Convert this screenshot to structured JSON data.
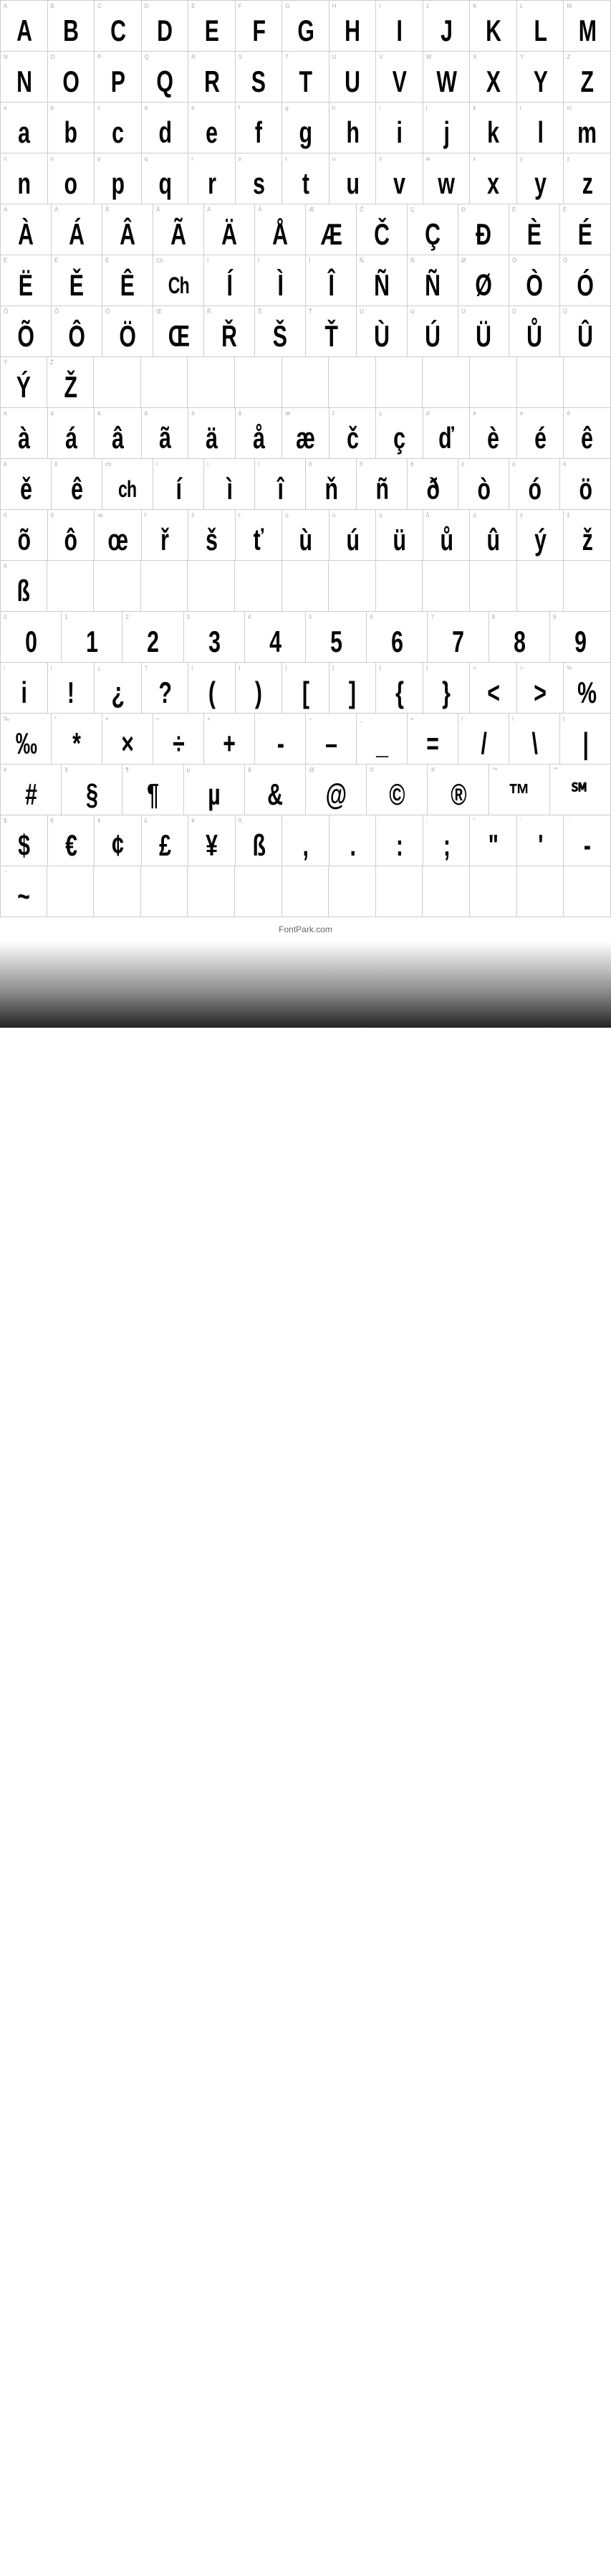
{
  "rows": [
    {
      "id": "row-upper-1",
      "cells": [
        {
          "label": "A",
          "char": "A"
        },
        {
          "label": "B",
          "char": "B"
        },
        {
          "label": "C",
          "char": "C"
        },
        {
          "label": "D",
          "char": "D"
        },
        {
          "label": "E",
          "char": "E"
        },
        {
          "label": "F",
          "char": "F"
        },
        {
          "label": "G",
          "char": "G"
        },
        {
          "label": "H",
          "char": "H"
        },
        {
          "label": "I",
          "char": "I"
        },
        {
          "label": "J",
          "char": "J"
        },
        {
          "label": "K",
          "char": "K"
        },
        {
          "label": "L",
          "char": "L"
        },
        {
          "label": "M",
          "char": "M"
        }
      ]
    },
    {
      "id": "row-upper-2",
      "cells": [
        {
          "label": "N",
          "char": "N"
        },
        {
          "label": "O",
          "char": "O"
        },
        {
          "label": "P",
          "char": "P"
        },
        {
          "label": "Q",
          "char": "Q"
        },
        {
          "label": "R",
          "char": "R"
        },
        {
          "label": "S",
          "char": "S"
        },
        {
          "label": "T",
          "char": "T"
        },
        {
          "label": "U",
          "char": "U"
        },
        {
          "label": "V",
          "char": "V"
        },
        {
          "label": "W",
          "char": "W"
        },
        {
          "label": "X",
          "char": "X"
        },
        {
          "label": "Y",
          "char": "Y"
        },
        {
          "label": "Z",
          "char": "Z"
        }
      ]
    },
    {
      "id": "row-lower-1",
      "cells": [
        {
          "label": "a",
          "char": "a"
        },
        {
          "label": "b",
          "char": "b"
        },
        {
          "label": "c",
          "char": "c"
        },
        {
          "label": "d",
          "char": "d"
        },
        {
          "label": "e",
          "char": "e"
        },
        {
          "label": "f",
          "char": "f"
        },
        {
          "label": "g",
          "char": "g"
        },
        {
          "label": "h",
          "char": "h"
        },
        {
          "label": "i",
          "char": "i"
        },
        {
          "label": "j",
          "char": "j"
        },
        {
          "label": "k",
          "char": "k"
        },
        {
          "label": "l",
          "char": "l"
        },
        {
          "label": "m",
          "char": "m"
        }
      ]
    },
    {
      "id": "row-lower-2",
      "cells": [
        {
          "label": "n",
          "char": "n"
        },
        {
          "label": "o",
          "char": "o"
        },
        {
          "label": "p",
          "char": "p"
        },
        {
          "label": "q",
          "char": "q"
        },
        {
          "label": "r",
          "char": "r"
        },
        {
          "label": "s",
          "char": "s"
        },
        {
          "label": "t",
          "char": "t"
        },
        {
          "label": "u",
          "char": "u"
        },
        {
          "label": "v",
          "char": "v"
        },
        {
          "label": "w",
          "char": "w"
        },
        {
          "label": "x",
          "char": "x"
        },
        {
          "label": "y",
          "char": "y"
        },
        {
          "label": "z",
          "char": "z"
        }
      ]
    },
    {
      "id": "row-accent-1",
      "cells": [
        {
          "label": "À",
          "char": "À"
        },
        {
          "label": "Á",
          "char": "Á"
        },
        {
          "label": "Â",
          "char": "Â"
        },
        {
          "label": "Ã",
          "char": "Ã"
        },
        {
          "label": "Ä",
          "char": "Ä"
        },
        {
          "label": "Å",
          "char": "Å"
        },
        {
          "label": "Æ",
          "char": "Æ"
        },
        {
          "label": "Č",
          "char": "Č"
        },
        {
          "label": "Ç",
          "char": "Ç"
        },
        {
          "label": "Ð",
          "char": "Ð"
        },
        {
          "label": "È",
          "char": "È"
        },
        {
          "label": "É",
          "char": "É"
        }
      ]
    },
    {
      "id": "row-accent-2",
      "cells": [
        {
          "label": "Ë",
          "char": "Ë"
        },
        {
          "label": "Ě",
          "char": "Ě"
        },
        {
          "label": "Ê",
          "char": "Ê"
        },
        {
          "label": "Ch",
          "char": "Ch"
        },
        {
          "label": "Í",
          "char": "Í"
        },
        {
          "label": "Ì",
          "char": "Ì"
        },
        {
          "label": "Î",
          "char": "Î"
        },
        {
          "label": "Ñ",
          "char": "Ñ"
        },
        {
          "label": "Ñ",
          "char": "Ñ"
        },
        {
          "label": "Ø",
          "char": "Ø"
        },
        {
          "label": "Ò",
          "char": "Ò"
        },
        {
          "label": "Ó",
          "char": "Ó"
        }
      ]
    },
    {
      "id": "row-accent-3",
      "cells": [
        {
          "label": "Õ",
          "char": "Õ"
        },
        {
          "label": "Ô",
          "char": "Ô"
        },
        {
          "label": "Ö",
          "char": "Ö"
        },
        {
          "label": "Œ",
          "char": "Œ"
        },
        {
          "label": "Ř",
          "char": "Ř"
        },
        {
          "label": "Š",
          "char": "Š"
        },
        {
          "label": "Ť",
          "char": "Ť"
        },
        {
          "label": "Ù",
          "char": "Ù"
        },
        {
          "label": "Ú",
          "char": "Ú"
        },
        {
          "label": "Ü",
          "char": "Ü"
        },
        {
          "label": "Ů",
          "char": "Ů"
        },
        {
          "label": "Û",
          "char": "Û"
        }
      ]
    },
    {
      "id": "row-accent-4",
      "cells": [
        {
          "label": "Ý",
          "char": "Ý"
        },
        {
          "label": "Ž",
          "char": "Ž"
        }
      ],
      "partial": true
    },
    {
      "id": "row-accent-lower-1",
      "cells": [
        {
          "label": "à",
          "char": "à"
        },
        {
          "label": "á",
          "char": "á"
        },
        {
          "label": "â",
          "char": "â"
        },
        {
          "label": "ã",
          "char": "ã"
        },
        {
          "label": "ä",
          "char": "ä"
        },
        {
          "label": "å",
          "char": "å"
        },
        {
          "label": "æ",
          "char": "æ"
        },
        {
          "label": "č",
          "char": "č"
        },
        {
          "label": "ç",
          "char": "ç"
        },
        {
          "label": "ď",
          "char": "ď"
        },
        {
          "label": "è",
          "char": "è"
        },
        {
          "label": "é",
          "char": "é"
        },
        {
          "label": "ê",
          "char": "ê"
        }
      ]
    },
    {
      "id": "row-accent-lower-2",
      "cells": [
        {
          "label": "ě",
          "char": "ě"
        },
        {
          "label": "ê",
          "char": "ê"
        },
        {
          "label": "ch",
          "char": "ch"
        },
        {
          "label": "í",
          "char": "í"
        },
        {
          "label": "ì",
          "char": "ì"
        },
        {
          "label": "î",
          "char": "î"
        },
        {
          "label": "ň",
          "char": "ň"
        },
        {
          "label": "ñ",
          "char": "ñ"
        },
        {
          "label": "ð",
          "char": "ð"
        },
        {
          "label": "ò",
          "char": "ò"
        },
        {
          "label": "ó",
          "char": "ó"
        },
        {
          "label": "ö",
          "char": "ö"
        }
      ]
    },
    {
      "id": "row-accent-lower-3",
      "cells": [
        {
          "label": "õ",
          "char": "õ"
        },
        {
          "label": "ô",
          "char": "ô"
        },
        {
          "label": "œ",
          "char": "œ"
        },
        {
          "label": "ř",
          "char": "ř"
        },
        {
          "label": "š",
          "char": "š"
        },
        {
          "label": "ť",
          "char": "ť"
        },
        {
          "label": "ù",
          "char": "ù"
        },
        {
          "label": "ú",
          "char": "ú"
        },
        {
          "label": "ü",
          "char": "ü"
        },
        {
          "label": "ů",
          "char": "ů"
        },
        {
          "label": "û",
          "char": "û"
        },
        {
          "label": "ý",
          "char": "ý"
        },
        {
          "label": "ž",
          "char": "ž"
        }
      ]
    },
    {
      "id": "row-accent-lower-4",
      "cells": [
        {
          "label": "ß",
          "char": "ß"
        }
      ],
      "partial": true
    },
    {
      "id": "row-numbers",
      "cells": [
        {
          "label": "0",
          "char": "0"
        },
        {
          "label": "1",
          "char": "1"
        },
        {
          "label": "2",
          "char": "2"
        },
        {
          "label": "3",
          "char": "3"
        },
        {
          "label": "4",
          "char": "4"
        },
        {
          "label": "5",
          "char": "5"
        },
        {
          "label": "6",
          "char": "6"
        },
        {
          "label": "7",
          "char": "7"
        },
        {
          "label": "8",
          "char": "8"
        },
        {
          "label": "9",
          "char": "9"
        }
      ]
    },
    {
      "id": "row-punct-1",
      "cells": [
        {
          "label": "i",
          "char": "i"
        },
        {
          "label": "!",
          "char": "!"
        },
        {
          "label": "¿",
          "char": "¿"
        },
        {
          "label": "?",
          "char": "?"
        },
        {
          "label": "(",
          "char": "("
        },
        {
          "label": ")",
          "char": ")"
        },
        {
          "label": "[",
          "char": "["
        },
        {
          "label": "]",
          "char": "]"
        },
        {
          "label": "{",
          "char": "{"
        },
        {
          "label": "}",
          "char": "}"
        },
        {
          "label": "<",
          "char": "<"
        },
        {
          "label": ">",
          "char": ">"
        },
        {
          "label": "%",
          "char": "%"
        }
      ]
    },
    {
      "id": "row-punct-2",
      "cells": [
        {
          "label": "‰",
          "char": "‰"
        },
        {
          "label": "*",
          "char": "*"
        },
        {
          "label": "×",
          "char": "×"
        },
        {
          "label": "÷",
          "char": "÷"
        },
        {
          "label": "+",
          "char": "+"
        },
        {
          "label": "-",
          "char": "-"
        },
        {
          "label": "–",
          "char": "–"
        },
        {
          "label": "_",
          "char": "_"
        },
        {
          "label": "=",
          "char": "="
        },
        {
          "label": "/",
          "char": "/"
        },
        {
          "label": "\\",
          "char": "\\"
        },
        {
          "label": "|",
          "char": "|"
        }
      ]
    },
    {
      "id": "row-punct-3",
      "cells": [
        {
          "label": "#",
          "char": "#"
        },
        {
          "label": "§",
          "char": "§"
        },
        {
          "label": "¶",
          "char": "¶"
        },
        {
          "label": "µ",
          "char": "µ"
        },
        {
          "label": "&",
          "char": "&"
        },
        {
          "label": "@",
          "char": "@"
        },
        {
          "label": "©",
          "char": "©"
        },
        {
          "label": "®",
          "char": "®"
        },
        {
          "label": "™",
          "char": "™"
        },
        {
          "label": "℠",
          "char": "℠"
        }
      ]
    },
    {
      "id": "row-punct-4",
      "cells": [
        {
          "label": "$",
          "char": "$"
        },
        {
          "label": "€",
          "char": "€"
        },
        {
          "label": "¢",
          "char": "¢"
        },
        {
          "label": "£",
          "char": "£"
        },
        {
          "label": "¥",
          "char": "¥"
        },
        {
          "label": "ß",
          "char": "ß"
        },
        {
          "label": ",",
          "char": ","
        },
        {
          "label": ".",
          "char": "."
        },
        {
          "label": ":",
          "char": ":"
        },
        {
          "label": ";",
          "char": ";"
        },
        {
          "label": "\"",
          "char": "\""
        },
        {
          "label": "'",
          "char": "'"
        },
        {
          "label": "-",
          "char": "-"
        }
      ]
    },
    {
      "id": "row-tilde",
      "cells": [
        {
          "label": "~",
          "char": "~"
        }
      ],
      "partial": true
    }
  ],
  "footer": {
    "text": "FontPark.com"
  }
}
